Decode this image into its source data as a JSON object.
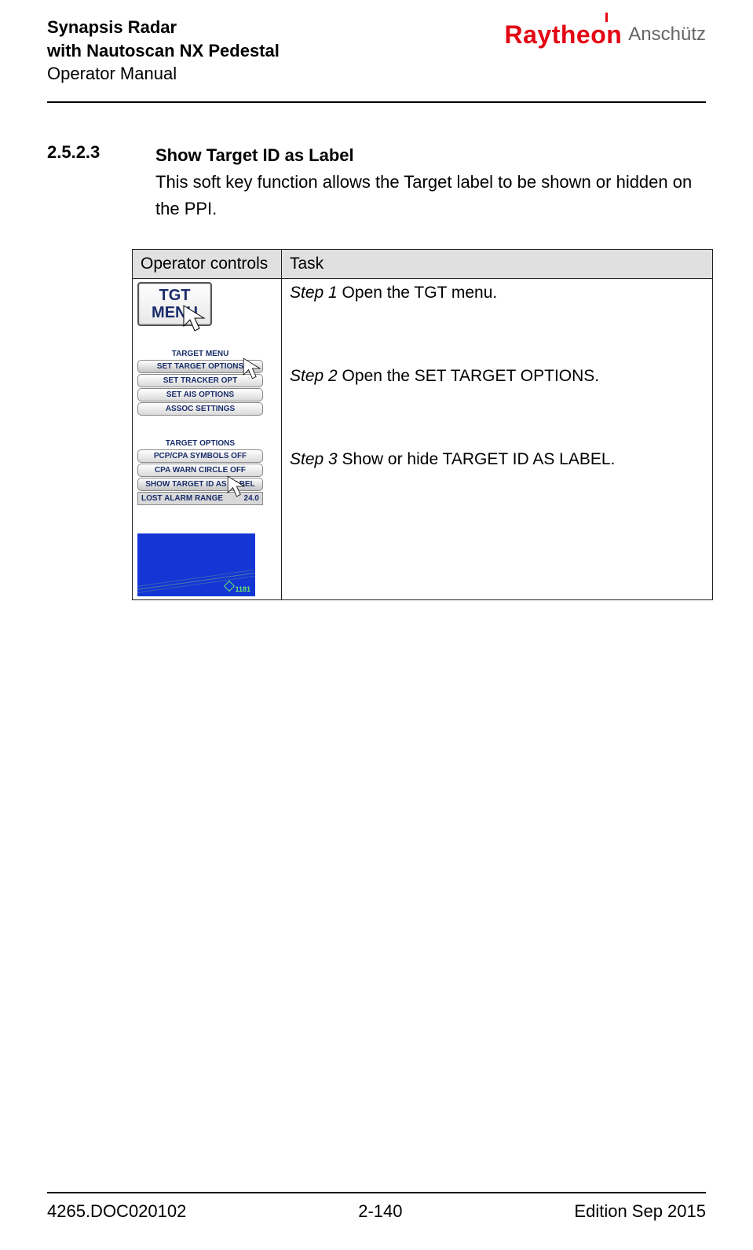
{
  "header": {
    "title_line1": "Synapsis Radar",
    "title_line2": "with Nautoscan NX Pedestal",
    "subtitle": "Operator Manual",
    "brand_main": "Raytheon",
    "brand_sub": "Anschütz"
  },
  "section": {
    "number": "2.5.2.3",
    "title": "Show Target ID as Label",
    "description": "This soft key function allows the Target label to be shown or hidden on the PPI."
  },
  "table": {
    "col1": "Operator controls",
    "col2": "Task",
    "steps": {
      "step1_num": "Step 1",
      "step1_text": " Open the TGT menu.",
      "step2_num": "Step 2",
      "step2_text": " Open the SET TARGET OPTIONS.",
      "step3_num": "Step 3",
      "step3_text": " Show or hide TARGET ID AS LABEL."
    },
    "ui": {
      "tgt_button_line1": "TGT",
      "tgt_button_line2": "MENU",
      "menu1_title": "TARGET MENU",
      "menu1_items": [
        "SET TARGET OPTIONS",
        "SET TRACKER OPT",
        "SET AIS OPTIONS",
        "ASSOC SETTINGS"
      ],
      "menu2_title": "TARGET OPTIONS",
      "menu2_items": [
        "PCP/CPA SYMBOLS OFF",
        "CPA WARN CIRCLE OFF",
        "SHOW TARGET ID AS LABEL"
      ],
      "menu2_lost_label": "LOST ALARM RANGE",
      "menu2_lost_value": "24.0",
      "ppi_target_id": "1181"
    }
  },
  "footer": {
    "doc_id": "4265.DOC020102",
    "page": "2-140",
    "edition": "Edition Sep 2015"
  }
}
